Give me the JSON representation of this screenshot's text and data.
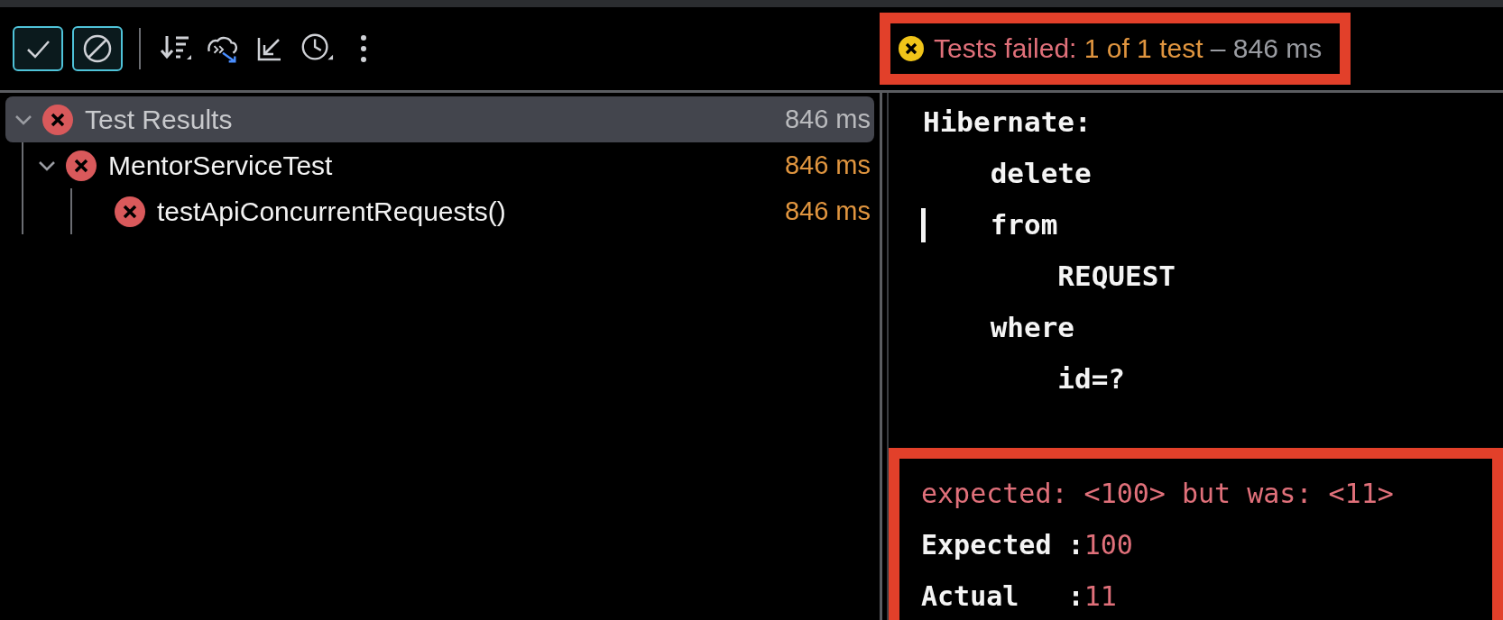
{
  "toolbar": {
    "buttons": [
      {
        "kind": "check",
        "on": true
      },
      {
        "kind": "stop",
        "on": true
      },
      {
        "kind": "separator"
      },
      {
        "kind": "sort",
        "on": false
      },
      {
        "kind": "import",
        "on": false
      },
      {
        "kind": "collapse",
        "on": false
      },
      {
        "kind": "history",
        "on": false
      },
      {
        "kind": "more",
        "on": false
      }
    ]
  },
  "status": {
    "highlighted": true,
    "kind": "failed",
    "parts": [
      {
        "kind": "failed",
        "text": "Tests failed: "
      },
      {
        "kind": "count",
        "text": "1 of 1 test"
      },
      {
        "kind": "time",
        "text": " – 846 ms"
      }
    ]
  },
  "tree": [
    {
      "label": "Test Results",
      "duration": "846 ms",
      "kind": "failed",
      "selected": true,
      "expanded": true,
      "children": [
        {
          "label": "MentorServiceTest",
          "duration": "846 ms",
          "kind": "failed",
          "selected": false,
          "expanded": true,
          "children": [
            {
              "label": "testApiConcurrentRequests()",
              "duration": "846 ms",
              "kind": "failed",
              "selected": false
            }
          ]
        }
      ]
    }
  ],
  "console": {
    "lines": [
      {
        "text": "Hibernate:",
        "cursor": false
      },
      {
        "text": "    delete",
        "cursor": false
      },
      {
        "text": "    from",
        "cursor": true
      },
      {
        "text": "        REQUEST",
        "cursor": false
      },
      {
        "text": "    where",
        "cursor": false
      },
      {
        "text": "        id=?",
        "cursor": false
      }
    ],
    "assertion": {
      "highlighted": true,
      "message": "expected: <100> but was: <11>",
      "rows": [
        {
          "label": "Expected :",
          "value": "100"
        },
        {
          "label": "Actual   :",
          "value": "11"
        }
      ]
    }
  }
}
